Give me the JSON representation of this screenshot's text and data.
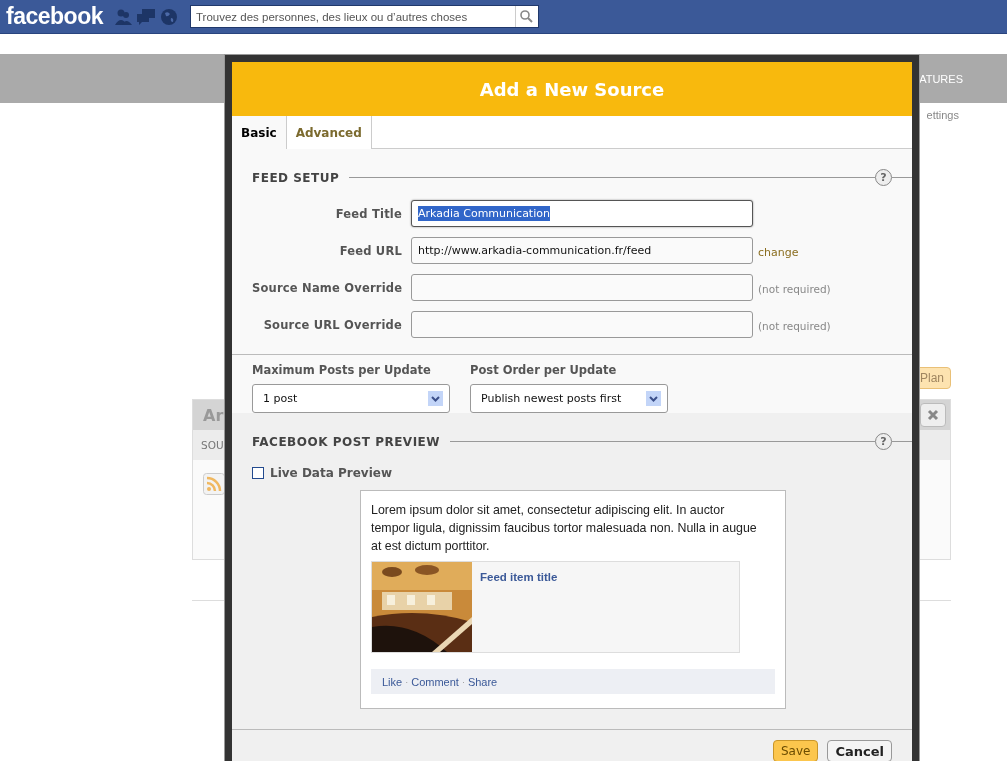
{
  "topbar": {
    "logo": "facebook",
    "search": {
      "placeholder": "Trouvez des personnes, des lieux ou d’autres choses"
    }
  },
  "background": {
    "nav_item": "ATURES",
    "settings_link": "ettings",
    "plan_button": "Plan",
    "card": {
      "title": "Ar",
      "subheader": "SOU"
    }
  },
  "dialog": {
    "title": "Add a New Source",
    "tabs": [
      {
        "label": "Basic",
        "selected": true
      },
      {
        "label": "Advanced",
        "selected": false
      }
    ],
    "feed_setup": {
      "heading": "FEED SETUP",
      "help": "?",
      "fields": [
        {
          "label": "Feed Title",
          "value": "Arkadia Communication",
          "highlighted": true
        },
        {
          "label": "Feed URL",
          "value": "http://www.arkadia-communication.fr/feed",
          "highlighted": false,
          "action": "change"
        },
        {
          "label": "Source Name Override",
          "highlighted": false,
          "note": "(not required)"
        },
        {
          "label": "Source URL Override",
          "highlighted": false,
          "note": "(not required)"
        }
      ]
    },
    "selects": [
      {
        "label": "Maximum Posts per Update",
        "value": "1 post"
      },
      {
        "label": "Post Order per Update",
        "value": "Publish newest posts first"
      }
    ],
    "preview": {
      "heading": "FACEBOOK POST PREVIEW",
      "help": "?",
      "checkbox": {
        "label": "Live Data Preview",
        "checked": false
      },
      "post": {
        "message": "Lorem ipsum dolor sit amet, consectetur adipiscing elit. In auctor tempor ligula, dignissim faucibus tortor malesuada non. Nulla in augue at est dictum porttitor.",
        "attachment": {
          "kind": "picture",
          "title": "Feed item title"
        },
        "separator": "·",
        "actions": [
          "Like",
          "Comment",
          "Share"
        ]
      }
    },
    "buttons": [
      {
        "label": "Save",
        "kind": "primary"
      },
      {
        "label": "Cancel",
        "kind": "secondary"
      }
    ]
  }
}
